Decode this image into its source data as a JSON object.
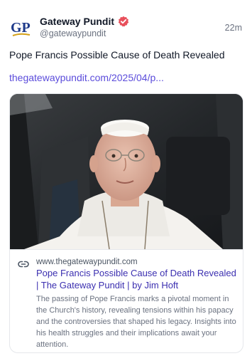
{
  "post": {
    "author_name": "Gateway Pundit",
    "author_handle": "@gatewaypundit",
    "avatar_text": "GP",
    "time": "22m",
    "text": "Pope Francis Possible Cause of Death Revealed",
    "link_text": "thegatewaypundit.com/2025/04/p..."
  },
  "card": {
    "domain": "www.thegatewaypundit.com",
    "title": "Pope Francis Possible Cause of Death Revealed | The Gateway Pundit | by Jim Hoft",
    "description": "The passing of Pope Francis marks a pivotal moment in the Church's history, revealing tensions within his papacy and the controversies that shaped his legacy. Insights into his health struggles and their implications await your attention."
  },
  "colors": {
    "verified_badge": "#e8505b",
    "link": "#5b4cdb",
    "card_title": "#3b2fb0",
    "avatar_blue": "#1e3a8a",
    "avatar_gold": "#d4a017"
  },
  "icons": {
    "verified": "verified-check-icon",
    "link": "link-chain-icon"
  }
}
